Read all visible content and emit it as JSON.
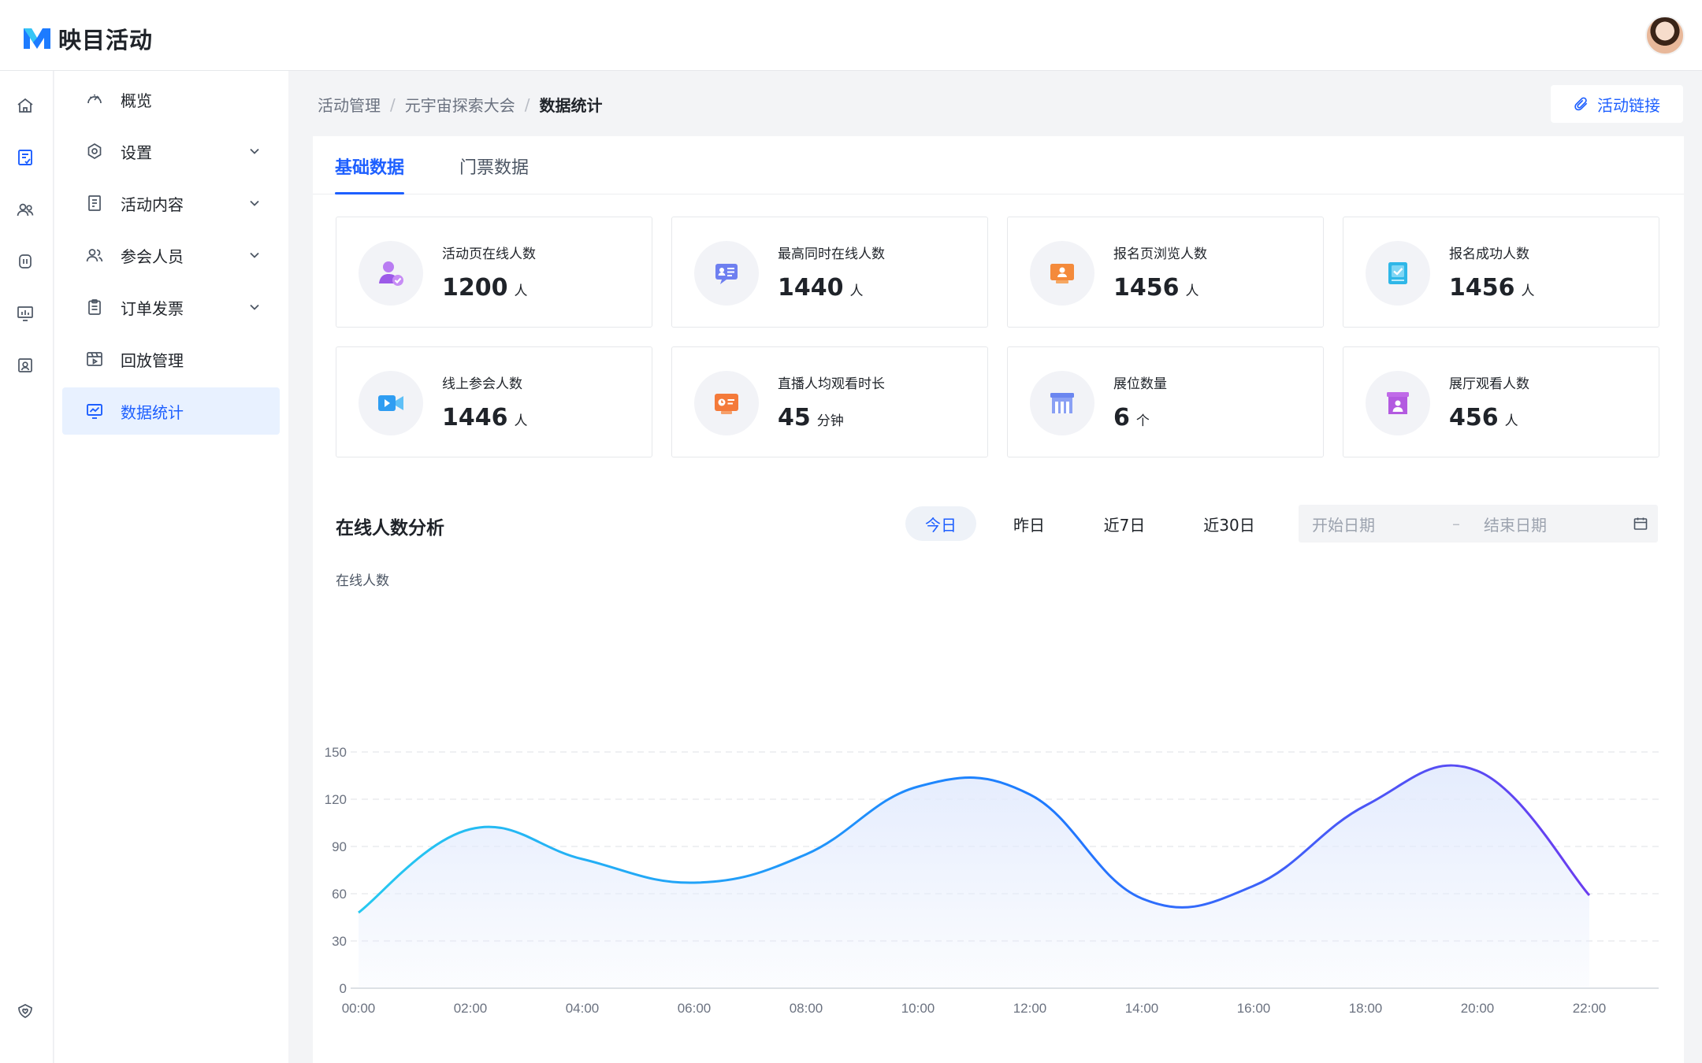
{
  "app": {
    "name": "映目活动"
  },
  "colors": {
    "primary": "#1d5fff",
    "active_bg": "#e8f1ff"
  },
  "rail": {
    "icons": [
      "home-icon",
      "activity-icon",
      "people-icon",
      "device-icon",
      "monitor-icon",
      "contact-card-icon",
      "shield-heart-icon"
    ]
  },
  "sidebar": {
    "items": [
      {
        "label": "概览",
        "icon": "dashboard-icon",
        "expandable": false
      },
      {
        "label": "设置",
        "icon": "gear-icon",
        "expandable": true
      },
      {
        "label": "活动内容",
        "icon": "document-icon",
        "expandable": true
      },
      {
        "label": "参会人员",
        "icon": "people-icon",
        "expandable": true
      },
      {
        "label": "订单发票",
        "icon": "clipboard-icon",
        "expandable": true
      },
      {
        "label": "回放管理",
        "icon": "playback-icon",
        "expandable": false
      },
      {
        "label": "数据统计",
        "icon": "chart-monitor-icon",
        "expandable": false,
        "active": true
      }
    ]
  },
  "breadcrumb": [
    "活动管理",
    "元宇宙探索大会",
    "数据统计"
  ],
  "header": {
    "link_button": "活动链接"
  },
  "tabs": [
    {
      "label": "基础数据",
      "active": true
    },
    {
      "label": "门票数据",
      "active": false
    }
  ],
  "stats": [
    {
      "label": "活动页在线人数",
      "value": "1200",
      "unit": "人",
      "icon": "user-check-icon"
    },
    {
      "label": "最高同时在线人数",
      "value": "1440",
      "unit": "人",
      "icon": "chat-card-icon"
    },
    {
      "label": "报名页浏览人数",
      "value": "1456",
      "unit": "人",
      "icon": "profile-screen-icon"
    },
    {
      "label": "报名成功人数",
      "value": "1456",
      "unit": "人",
      "icon": "checked-book-icon"
    },
    {
      "label": "线上参会人数",
      "value": "1446",
      "unit": "人",
      "icon": "video-camera-icon"
    },
    {
      "label": "直播人均观看时长",
      "value": "45",
      "unit": "分钟",
      "icon": "live-screen-icon"
    },
    {
      "label": "展位数量",
      "value": "6",
      "unit": "个",
      "icon": "booth-icon"
    },
    {
      "label": "展厅观看人数",
      "value": "456",
      "unit": "人",
      "icon": "hall-viewer-icon"
    }
  ],
  "analysis": {
    "title": "在线人数分析",
    "ranges": [
      {
        "label": "今日",
        "active": true
      },
      {
        "label": "昨日",
        "active": false
      },
      {
        "label": "近7日",
        "active": false
      },
      {
        "label": "近30日",
        "active": false
      }
    ],
    "date_start_placeholder": "开始日期",
    "date_separator": "–",
    "date_end_placeholder": "结束日期"
  },
  "chart_data": {
    "type": "area",
    "title": "",
    "xlabel": "",
    "ylabel": "在线人数",
    "x": [
      "00:00",
      "02:00",
      "04:00",
      "06:00",
      "08:00",
      "10:00",
      "12:00",
      "14:00",
      "16:00",
      "18:00",
      "20:00",
      "22:00"
    ],
    "series": [
      {
        "values": [
          48,
          101,
          82,
          67,
          85,
          128,
          123,
          57,
          65,
          116,
          138,
          59
        ]
      }
    ],
    "ylim": [
      0,
      150
    ],
    "yticks": [
      0,
      30,
      60,
      90,
      120,
      150
    ],
    "grid": true,
    "line_gradient": [
      "#26c9f0",
      "#1d7bff",
      "#6a3df0"
    ],
    "fill_color": "#e3ebfd"
  }
}
